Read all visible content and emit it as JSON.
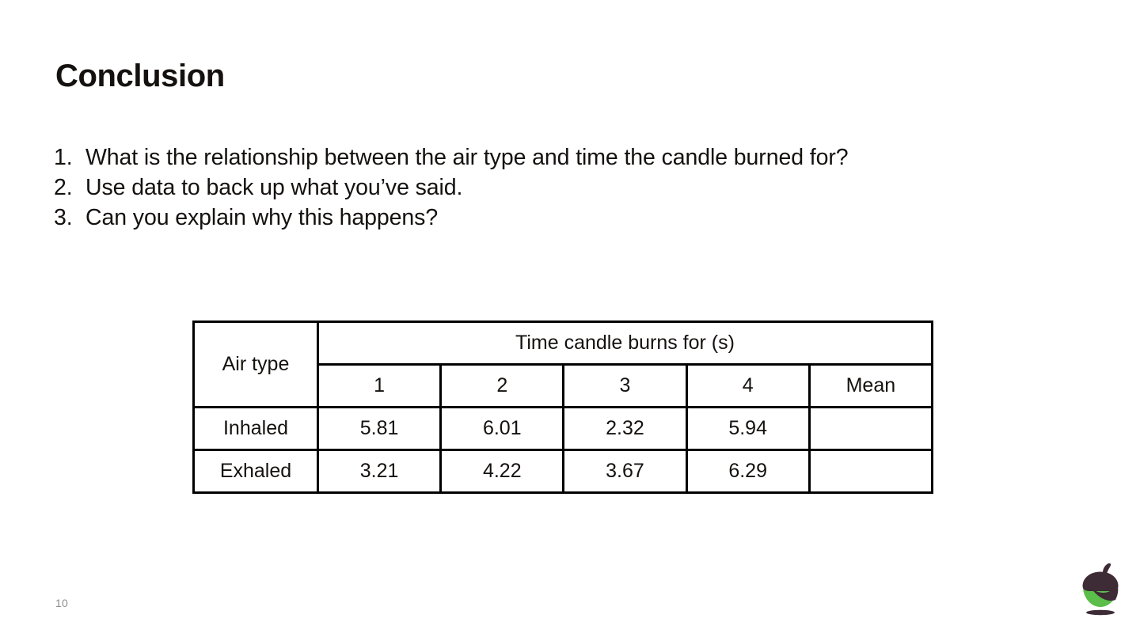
{
  "slide": {
    "title": "Conclusion",
    "page_number": "10",
    "background_color": "#ffffff",
    "text_color": "#14110f"
  },
  "questions": [
    {
      "number": "1.",
      "text": "What is the relationship between the air type and time the candle burned for?"
    },
    {
      "number": "2.",
      "text": "Use data to back up what you’ve said."
    },
    {
      "number": "3.",
      "text": "Can you explain why this happens?"
    }
  ],
  "table": {
    "row_label_header": "Air type",
    "group_header": "Time candle burns for (s)",
    "trial_headers": [
      "1",
      "2",
      "3",
      "4",
      "Mean"
    ],
    "rows": [
      {
        "label": "Inhaled",
        "values": [
          "5.81",
          "6.01",
          "2.32",
          "5.94"
        ],
        "mean": ""
      },
      {
        "label": "Exhaled",
        "values": [
          "3.21",
          "4.22",
          "3.67",
          "6.29"
        ],
        "mean": ""
      }
    ],
    "border_color": "#000000"
  },
  "logo": {
    "name": "acorn-logo",
    "cap_color": "#3d2b35",
    "body_color": "#5cbe4a",
    "shadow_color": "#3d2b35"
  }
}
